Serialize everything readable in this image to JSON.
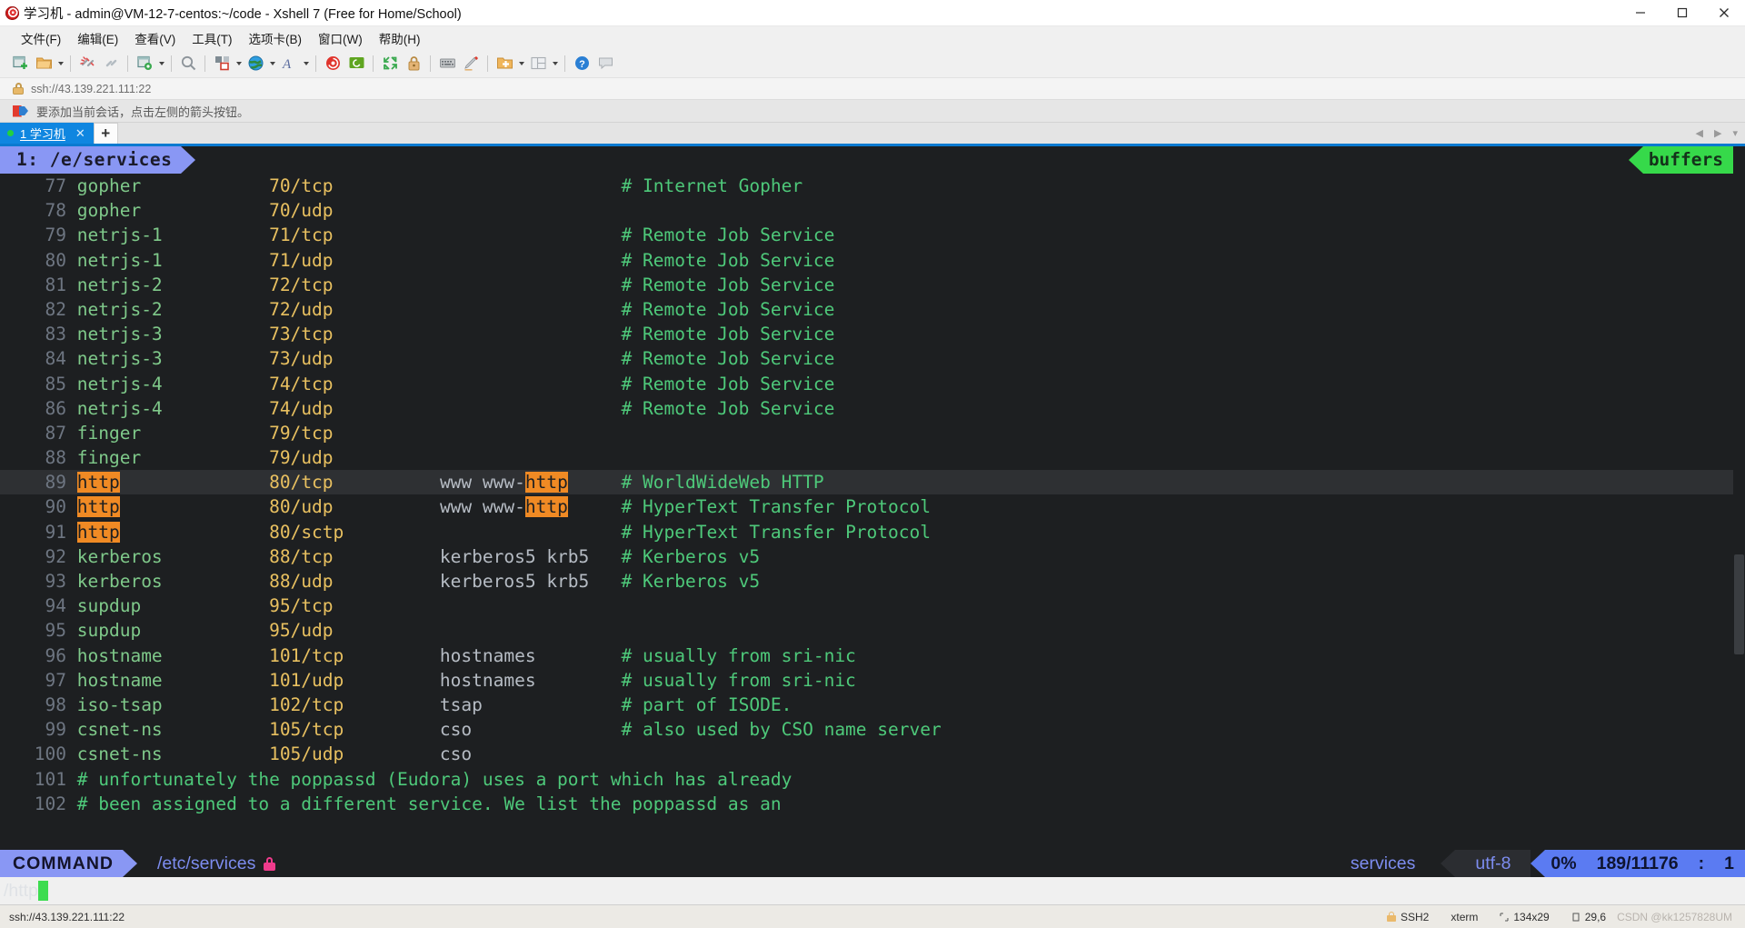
{
  "window": {
    "title": "学习机 - admin@VM-12-7-centos:~/code - Xshell 7 (Free for Home/School)",
    "app_icon": "snail-icon",
    "minimize": "–",
    "maximize": "□",
    "close": "✕"
  },
  "menu": {
    "items": [
      {
        "label": "文件(F)",
        "name": "menu-file"
      },
      {
        "label": "编辑(E)",
        "name": "menu-edit"
      },
      {
        "label": "查看(V)",
        "name": "menu-view"
      },
      {
        "label": "工具(T)",
        "name": "menu-tools"
      },
      {
        "label": "选项卡(B)",
        "name": "menu-tabs"
      },
      {
        "label": "窗口(W)",
        "name": "menu-window"
      },
      {
        "label": "帮助(H)",
        "name": "menu-help"
      }
    ]
  },
  "toolbar": {
    "items": [
      {
        "icon": "new-session-icon",
        "dropdown": false
      },
      {
        "icon": "open-folder-icon",
        "dropdown": true
      },
      {
        "sep": true
      },
      {
        "icon": "disconnect-icon",
        "dropdown": false
      },
      {
        "icon": "reconnect-icon",
        "dropdown": false
      },
      {
        "sep": true
      },
      {
        "icon": "session-properties-icon",
        "dropdown": true
      },
      {
        "sep": true
      },
      {
        "icon": "find-icon",
        "dropdown": false
      },
      {
        "sep": true
      },
      {
        "icon": "layout-icon",
        "dropdown": true
      },
      {
        "icon": "globe-icon",
        "dropdown": true
      },
      {
        "icon": "font-icon",
        "dropdown": true
      },
      {
        "sep": true
      },
      {
        "icon": "xshell-icon",
        "dropdown": false
      },
      {
        "icon": "xftp-icon",
        "dropdown": false
      },
      {
        "sep": true
      },
      {
        "icon": "fullscreen-icon",
        "dropdown": false
      },
      {
        "icon": "lock-icon",
        "dropdown": false
      },
      {
        "sep": true
      },
      {
        "icon": "keyboard-icon",
        "dropdown": false
      },
      {
        "icon": "highlight-pen-icon",
        "dropdown": false
      },
      {
        "sep": true
      },
      {
        "icon": "add-folder-icon",
        "dropdown": true
      },
      {
        "icon": "split-view-icon",
        "dropdown": true
      },
      {
        "sep": true
      },
      {
        "icon": "help-icon",
        "dropdown": false
      },
      {
        "icon": "chat-icon",
        "dropdown": false
      }
    ]
  },
  "address_bar": {
    "icon": "lock-icon",
    "url": "ssh://43.139.221.111:22"
  },
  "notice_bar": {
    "icon": "flag-arrow-icon",
    "text": "要添加当前会话，点击左侧的箭头按钮。"
  },
  "tabstrip": {
    "tabs": [
      {
        "status": "connected",
        "label": "1 学习机",
        "close": "✕"
      }
    ],
    "new_tab": "+",
    "scroll_left": "◀",
    "scroll_right": "▶",
    "tab_list": "▾"
  },
  "terminal": {
    "vim_tabline": {
      "left_label": "1: /e/services",
      "right_label": "buffers"
    },
    "lines": [
      {
        "num": "77",
        "service": "gopher",
        "port": "70/tcp",
        "aliases": "",
        "comment": "# Internet Gopher",
        "current": false
      },
      {
        "num": "78",
        "service": "gopher",
        "port": "70/udp",
        "aliases": "",
        "comment": "",
        "current": false
      },
      {
        "num": "79",
        "service": "netrjs-1",
        "port": "71/tcp",
        "aliases": "",
        "comment": "# Remote Job Service",
        "current": false
      },
      {
        "num": "80",
        "service": "netrjs-1",
        "port": "71/udp",
        "aliases": "",
        "comment": "# Remote Job Service",
        "current": false
      },
      {
        "num": "81",
        "service": "netrjs-2",
        "port": "72/tcp",
        "aliases": "",
        "comment": "# Remote Job Service",
        "current": false
      },
      {
        "num": "82",
        "service": "netrjs-2",
        "port": "72/udp",
        "aliases": "",
        "comment": "# Remote Job Service",
        "current": false
      },
      {
        "num": "83",
        "service": "netrjs-3",
        "port": "73/tcp",
        "aliases": "",
        "comment": "# Remote Job Service",
        "current": false
      },
      {
        "num": "84",
        "service": "netrjs-3",
        "port": "73/udp",
        "aliases": "",
        "comment": "# Remote Job Service",
        "current": false
      },
      {
        "num": "85",
        "service": "netrjs-4",
        "port": "74/tcp",
        "aliases": "",
        "comment": "# Remote Job Service",
        "current": false
      },
      {
        "num": "86",
        "service": "netrjs-4",
        "port": "74/udp",
        "aliases": "",
        "comment": "# Remote Job Service",
        "current": false
      },
      {
        "num": "87",
        "service": "finger",
        "port": "79/tcp",
        "aliases": "",
        "comment": "",
        "current": false
      },
      {
        "num": "88",
        "service": "finger",
        "port": "79/udp",
        "aliases": "",
        "comment": "",
        "current": false
      },
      {
        "num": "89",
        "service": "http",
        "port": "80/tcp",
        "aliases": "www www-http",
        "comment": "# WorldWideWeb HTTP",
        "current": true
      },
      {
        "num": "90",
        "service": "http",
        "port": "80/udp",
        "aliases": "www www-http",
        "comment": "# HyperText Transfer Protocol",
        "current": false
      },
      {
        "num": "91",
        "service": "http",
        "port": "80/sctp",
        "aliases": "",
        "comment": "# HyperText Transfer Protocol",
        "current": false
      },
      {
        "num": "92",
        "service": "kerberos",
        "port": "88/tcp",
        "aliases": "kerberos5 krb5",
        "comment": "# Kerberos v5",
        "current": false
      },
      {
        "num": "93",
        "service": "kerberos",
        "port": "88/udp",
        "aliases": "kerberos5 krb5",
        "comment": "# Kerberos v5",
        "current": false
      },
      {
        "num": "94",
        "service": "supdup",
        "port": "95/tcp",
        "aliases": "",
        "comment": "",
        "current": false
      },
      {
        "num": "95",
        "service": "supdup",
        "port": "95/udp",
        "aliases": "",
        "comment": "",
        "current": false
      },
      {
        "num": "96",
        "service": "hostname",
        "port": "101/tcp",
        "aliases": "hostnames",
        "comment": "# usually from sri-nic",
        "current": false
      },
      {
        "num": "97",
        "service": "hostname",
        "port": "101/udp",
        "aliases": "hostnames",
        "comment": "# usually from sri-nic",
        "current": false
      },
      {
        "num": "98",
        "service": "iso-tsap",
        "port": "102/tcp",
        "aliases": "tsap",
        "comment": "# part of ISODE.",
        "current": false
      },
      {
        "num": "99",
        "service": "csnet-ns",
        "port": "105/tcp",
        "aliases": "cso",
        "comment": "# also used by CSO name server",
        "current": false
      },
      {
        "num": "100",
        "service": "csnet-ns",
        "port": "105/udp",
        "aliases": "cso",
        "comment": "",
        "current": false
      },
      {
        "num": "101",
        "service": "",
        "port": "",
        "aliases": "",
        "comment": "# unfortunately the poppassd (Eudora) uses a port which has already",
        "current": false
      },
      {
        "num": "102",
        "service": "",
        "port": "",
        "aliases": "",
        "comment": "# been assigned to a different service. We list the poppassd as an",
        "current": false
      }
    ],
    "search_highlight": "http",
    "statusline": {
      "mode": "COMMAND",
      "file": "/etc/services",
      "readonly_icon": "lock-icon",
      "filetype": "services",
      "encoding": "utf-8",
      "percent": "0%",
      "position": "189/11176",
      "column_sep": ":",
      "column": "1"
    },
    "cmdline": "/http"
  },
  "status_bar": {
    "url": "ssh://43.139.221.111:22",
    "protocol": "SSH2",
    "terminal_type": "xterm",
    "size_icon": "resize-icon",
    "size": "134x29",
    "cursor_icon": "cursor-icon",
    "cursor": "29,6",
    "watermark": "CSDN @kk1257828UM"
  },
  "colors": {
    "accent_blue": "#0f86e0",
    "vim_purple": "#8997f4",
    "vim_green": "#36d94a",
    "highlight_orange": "#f08a24",
    "comment_green": "#4ec97a",
    "port_yellow": "#e8c060",
    "statusline_blue": "#5b7bf2"
  }
}
